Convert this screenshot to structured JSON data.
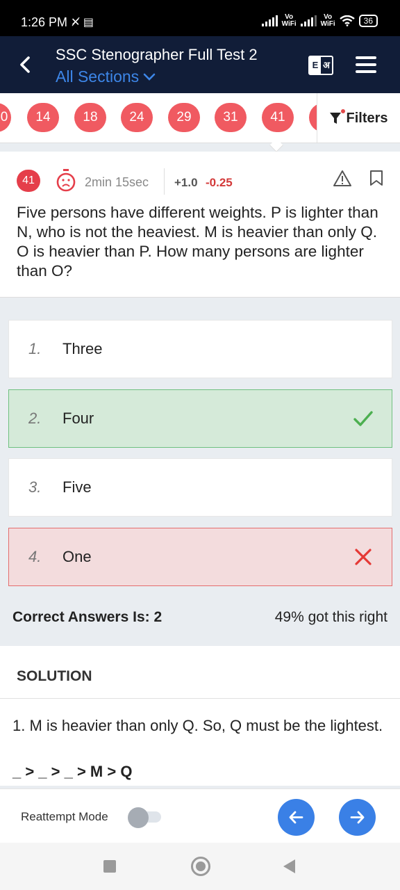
{
  "status_bar": {
    "time": "1:26 PM",
    "battery": "36",
    "net1": "Vo\nWiFi",
    "net2": "Vo\nWiFi"
  },
  "header": {
    "title": "SSC Stenographer Full Test 2",
    "subtitle": "All Sections",
    "lang_left": "E",
    "lang_right": "अ"
  },
  "question_strip": {
    "partial_left": "0",
    "chips": [
      "14",
      "18",
      "24",
      "29",
      "31",
      "41"
    ],
    "filters_label": "Filters"
  },
  "question": {
    "number": "41",
    "time_taken": "2min 15sec",
    "positive_marks": "+1.0",
    "negative_marks": "-0.25",
    "text": "Five persons have different weights. P is lighter than N, who is not the heaviest. M is heavier than only Q. O is heavier than P. How many persons are lighter than O?"
  },
  "options": [
    {
      "num": "1.",
      "text": "Three",
      "state": "neutral"
    },
    {
      "num": "2.",
      "text": "Four",
      "state": "correct"
    },
    {
      "num": "3.",
      "text": "Five",
      "state": "neutral"
    },
    {
      "num": "4.",
      "text": "One",
      "state": "wrong"
    }
  ],
  "answer_summary": {
    "correct_answer": "Correct Answers Is: 2",
    "percent_right": "49% got this right"
  },
  "solution": {
    "heading": "SOLUTION",
    "line1": "1. M is heavier than only Q. So, Q must be the lightest.",
    "line2": "_ > _ > _ > M > Q"
  },
  "bottom_bar": {
    "reattempt_label": "Reattempt Mode",
    "reattempt_on": false
  },
  "colors": {
    "header_bg": "#111d38",
    "accent_blue": "#3a80e6",
    "chip_red": "#f05a61",
    "correct_green": "#4caf50",
    "wrong_red": "#e53935"
  }
}
